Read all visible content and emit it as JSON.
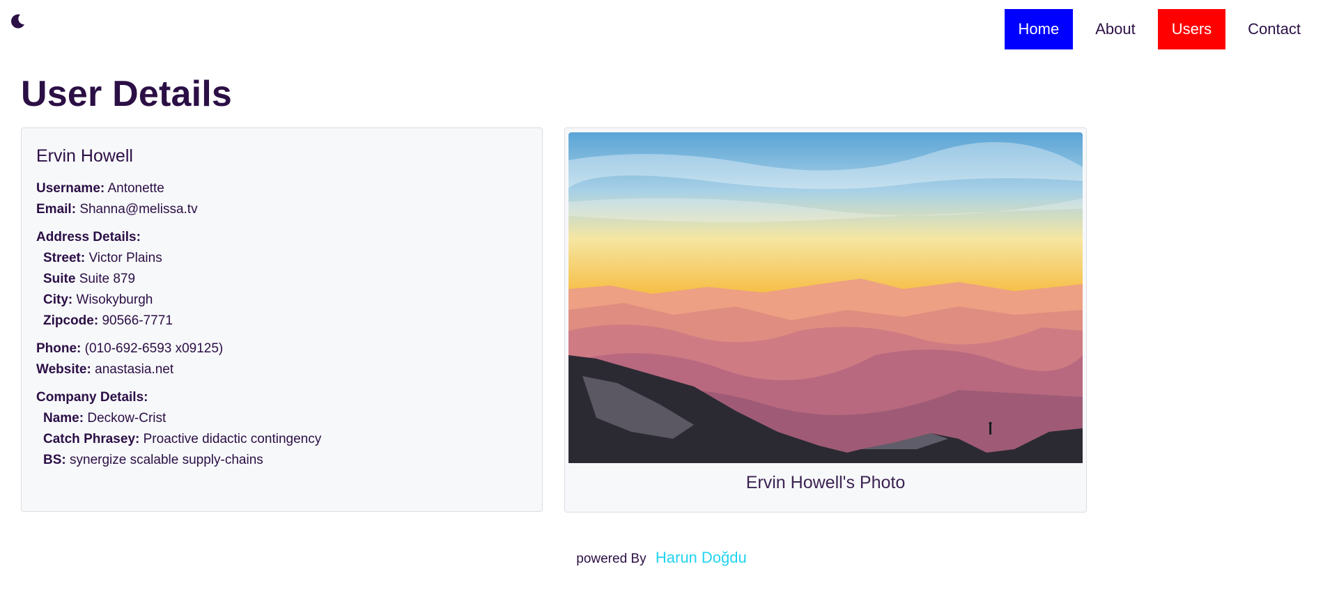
{
  "nav": {
    "home": "Home",
    "about": "About",
    "users": "Users",
    "contact": "Contact"
  },
  "page": {
    "title": "User Details"
  },
  "user": {
    "name": "Ervin Howell",
    "username_label": "Username:",
    "username": "Antonette",
    "email_label": "Email:",
    "email": "Shanna@melissa.tv",
    "address_heading": "Address Details:",
    "street_label": "Street:",
    "street": "Victor Plains",
    "suite_label": "Suite",
    "suite": "Suite 879",
    "city_label": "City:",
    "city": "Wisokyburgh",
    "zipcode_label": "Zipcode:",
    "zipcode": "90566-7771",
    "phone_label": "Phone:",
    "phone": "(010-692-6593 x09125)",
    "website_label": "Website:",
    "website": "anastasia.net",
    "company_heading": "Company Details:",
    "company_name_label": "Name:",
    "company_name": "Deckow-Crist",
    "catch_label": "Catch Phrasey:",
    "catch_phrase": "Proactive didactic contingency",
    "bs_label": "BS:",
    "bs": "synergize scalable supply-chains"
  },
  "photo": {
    "caption": "Ervin Howell's Photo"
  },
  "footer": {
    "powered": "powered By",
    "author": "Harun Doğdu"
  },
  "colors": {
    "text": "#2b0f45",
    "home_bg": "#0000ff",
    "users_bg": "#ff0000",
    "author": "#22d3ee"
  },
  "icons": {
    "theme_toggle": "moon-icon"
  }
}
